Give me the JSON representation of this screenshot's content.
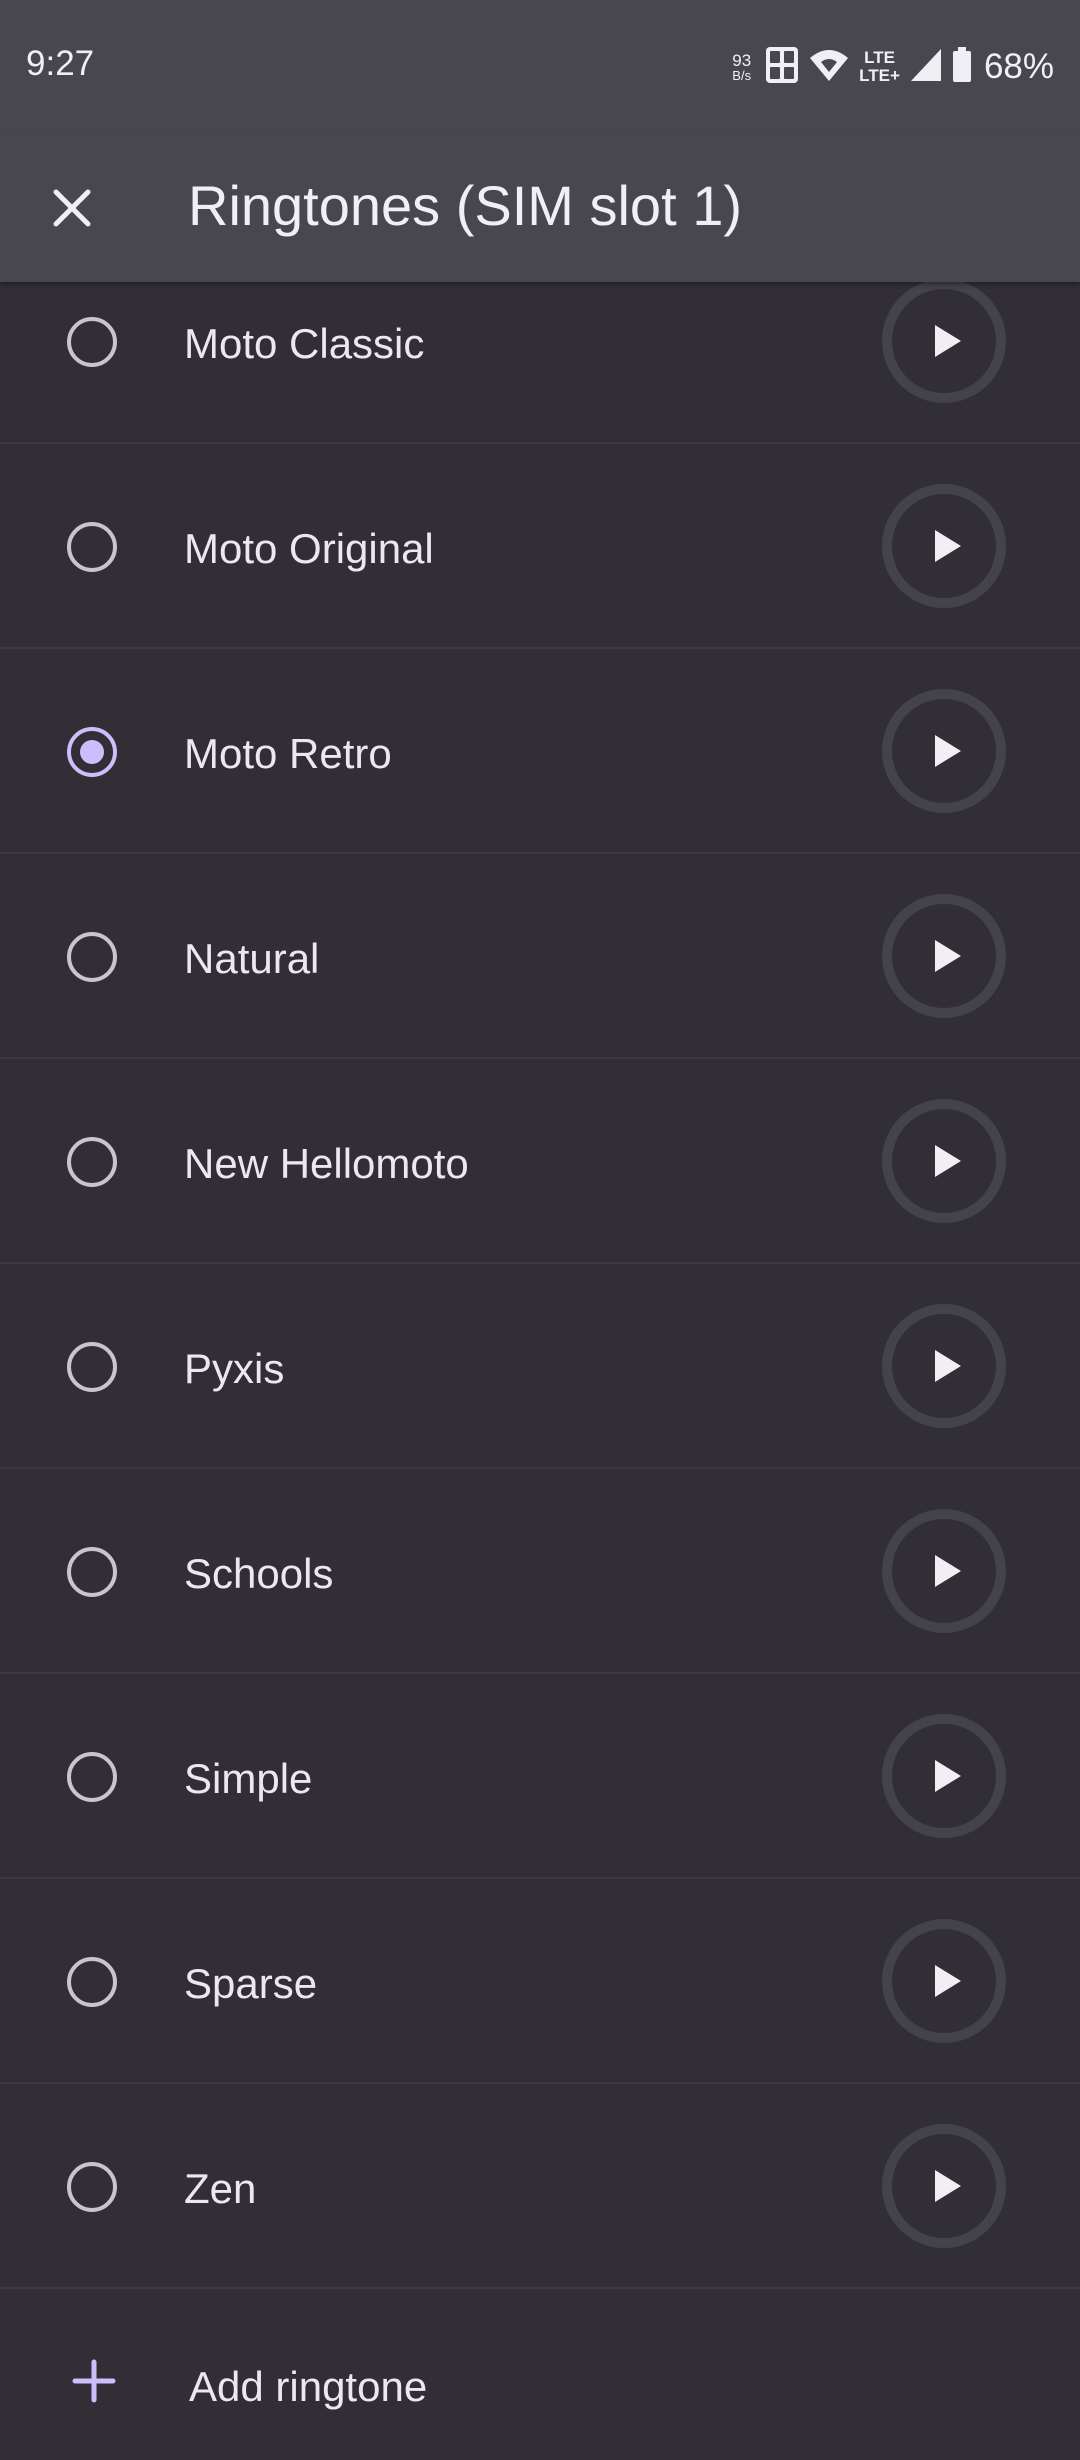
{
  "status_bar": {
    "time": "9:27",
    "net_speed_value": "93",
    "net_speed_unit": "B/s",
    "lte_top": "LTE",
    "lte_bottom": "LTE+",
    "battery": "68%"
  },
  "app_bar": {
    "title": "Ringtones (SIM slot 1)"
  },
  "ringtones": [
    {
      "label": "Moto Classic",
      "selected": false
    },
    {
      "label": "Moto Original",
      "selected": false
    },
    {
      "label": "Moto Retro",
      "selected": true
    },
    {
      "label": "Natural",
      "selected": false
    },
    {
      "label": "New Hellomoto",
      "selected": false
    },
    {
      "label": "Pyxis",
      "selected": false
    },
    {
      "label": "Schools",
      "selected": false
    },
    {
      "label": "Simple",
      "selected": false
    },
    {
      "label": "Sparse",
      "selected": false
    },
    {
      "label": "Zen",
      "selected": false
    }
  ],
  "add_ringtone_label": "Add ringtone",
  "colors": {
    "accent": "#cdbdfa",
    "background": "#312f35",
    "app_bar": "#48464f"
  }
}
